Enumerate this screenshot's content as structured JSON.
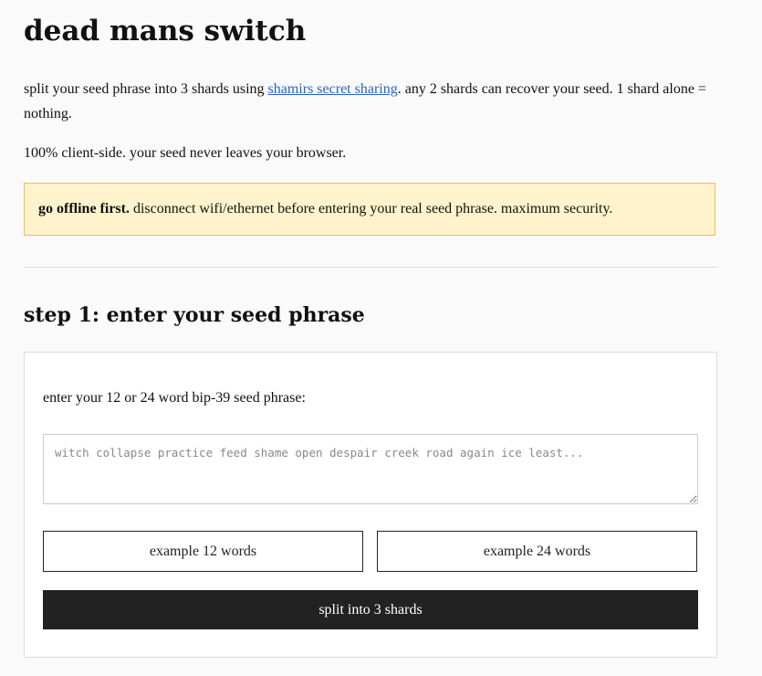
{
  "page": {
    "title": "dead mans switch",
    "intro_before_link": "split your seed phrase into 3 shards using ",
    "intro_link": "shamirs secret sharing",
    "intro_after_link": ". any 2 shards can recover your seed. 1 shard alone = nothing.",
    "client_side_note": "100% client-side. your seed never leaves your browser."
  },
  "warning": {
    "bold": "go offline first.",
    "text": " disconnect wifi/ethernet before entering your real seed phrase. maximum security.",
    "background_color": "#fff3cd",
    "border_color": "#f0c040"
  },
  "step1": {
    "heading": "step 1: enter your seed phrase",
    "prompt": "enter your 12 or 24 word bip-39 seed phrase:",
    "seed_input": {
      "value": "",
      "placeholder": "witch collapse practice feed shame open despair creek road again ice least..."
    },
    "example_12_label": "example 12 words",
    "example_24_label": "example 24 words",
    "split_label": "split into 3 shards"
  },
  "colors": {
    "link": "#2a62c9",
    "primary_button": "#222222"
  }
}
